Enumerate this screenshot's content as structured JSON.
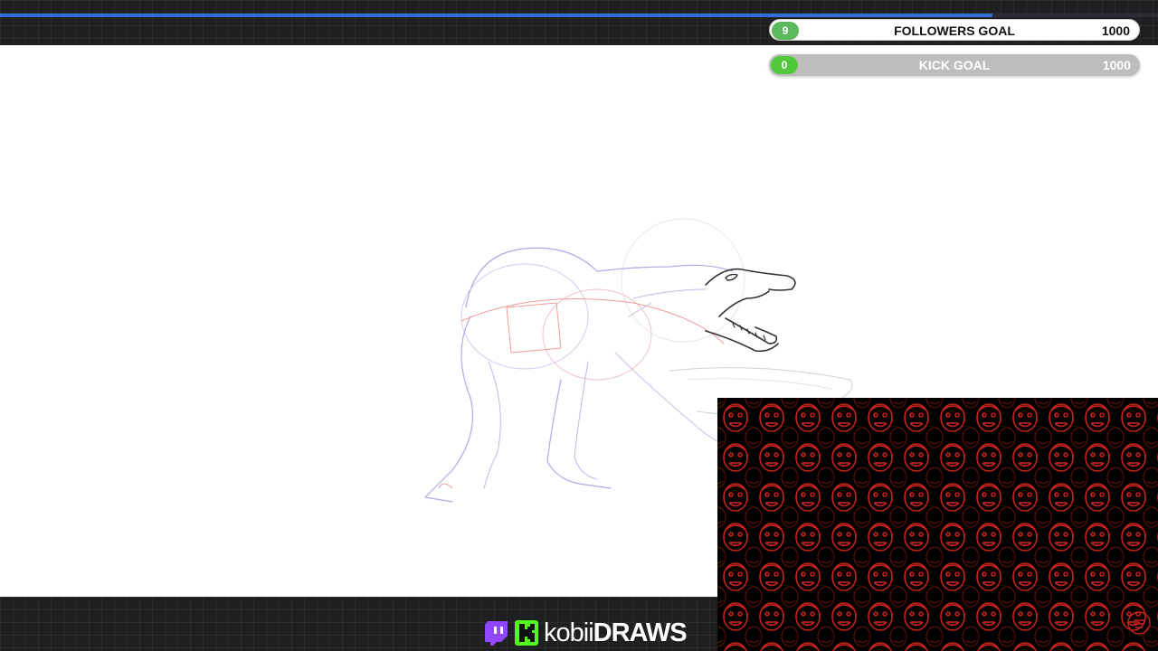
{
  "stream_progress": 0.857,
  "goals": {
    "followers": {
      "count": "9",
      "label": "FOLLOWERS GOAL",
      "target": "1000"
    },
    "kick": {
      "count": "0",
      "label": "KICK GOAL",
      "target": "1000"
    }
  },
  "brand": {
    "name_light": "kobii",
    "name_bold": "DRAWS"
  },
  "colors": {
    "accent_blue": "#2f6fd6",
    "goal_green": "#5cb85c",
    "kick_green": "#53fc18",
    "twitch_purple": "#9146ff",
    "cam_red": "#c4221c"
  },
  "icons": [
    "twitch-icon",
    "kick-icon",
    "bad-friends-logo"
  ]
}
